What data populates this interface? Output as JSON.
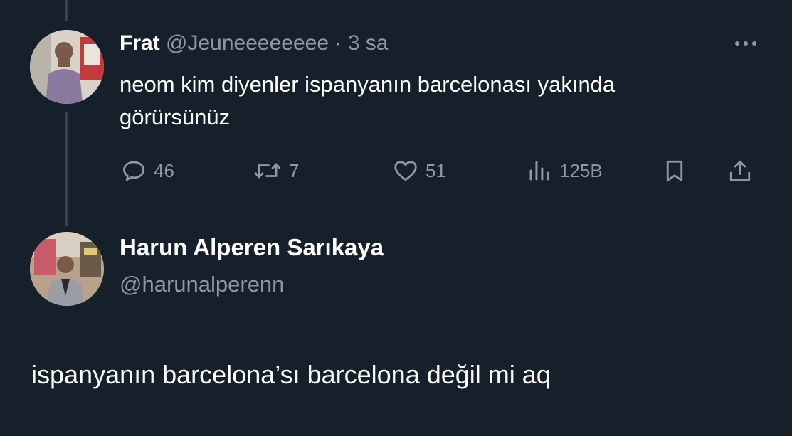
{
  "tweet1": {
    "display_name": "Frat",
    "handle": "@Jeuneeeeeeee",
    "separator": "·",
    "time": "3 sa",
    "text": "neom kim diyenler ispanyanın barcelonası yakında görürsünüz",
    "actions": {
      "reply_count": "46",
      "retweet_count": "7",
      "like_count": "51",
      "views_count": "125B"
    },
    "icons": {
      "more": "more-horizontal-icon",
      "reply": "reply-icon",
      "retweet": "retweet-icon",
      "like": "heart-icon",
      "views": "views-chart-icon",
      "bookmark": "bookmark-icon",
      "share": "share-icon"
    }
  },
  "tweet2": {
    "display_name": "Harun Alperen Sarıkaya",
    "handle": "@harunalperenn",
    "text": "ispanyanın barcelona’sı barcelona değil mi aq"
  },
  "colors": {
    "background": "#15202b",
    "text": "#ffffff",
    "muted": "#8b98a5",
    "thread_line": "#38444d"
  }
}
